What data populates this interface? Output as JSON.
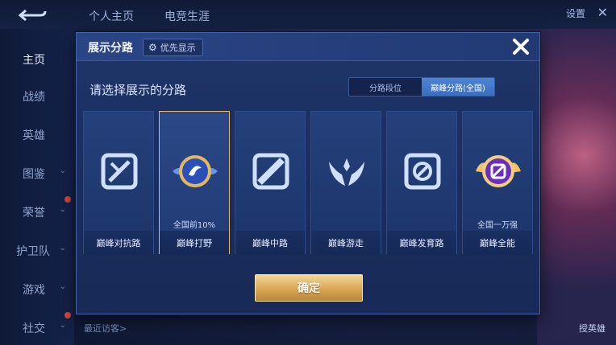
{
  "background": {
    "tabs": [
      "个人主页",
      "电竞生涯"
    ],
    "settings_label": "设置",
    "sidebar": [
      {
        "label": "主页",
        "active": true
      },
      {
        "label": "战绩"
      },
      {
        "label": "英雄"
      },
      {
        "label": "图鉴"
      },
      {
        "label": "荣誉"
      },
      {
        "label": "护卫队"
      },
      {
        "label": "游戏"
      },
      {
        "label": "社交"
      }
    ],
    "recent_visitors": "最近访客>",
    "right_caption": "授英雄"
  },
  "modal": {
    "title": "展示分路",
    "priority_label": "优先显示",
    "subtitle": "请选择展示的分路",
    "segments": [
      {
        "label": "分路段位",
        "active": false
      },
      {
        "label": "巅峰分路(全国)",
        "active": true
      }
    ],
    "cards": [
      {
        "label": "巅峰对抗路",
        "rank": "",
        "icon": "sword-shield-icon",
        "selected": false
      },
      {
        "label": "巅峰打野",
        "rank": "全国前10%",
        "icon": "jungle-badge-icon",
        "selected": true
      },
      {
        "label": "巅峰中路",
        "rank": "",
        "icon": "mid-lane-icon",
        "selected": false
      },
      {
        "label": "巅峰游走",
        "rank": "",
        "icon": "wings-icon",
        "selected": false
      },
      {
        "label": "巅峰发育路",
        "rank": "",
        "icon": "target-icon",
        "selected": false
      },
      {
        "label": "巅峰全能",
        "rank": "全国一万强",
        "icon": "allround-badge-icon",
        "selected": false
      }
    ],
    "confirm_label": "确定"
  },
  "colors": {
    "modal_bg": "#1f3569",
    "selected_border": "#e0b774",
    "confirm_gold": "#d9a757",
    "segment_active": "#4d86d6"
  }
}
